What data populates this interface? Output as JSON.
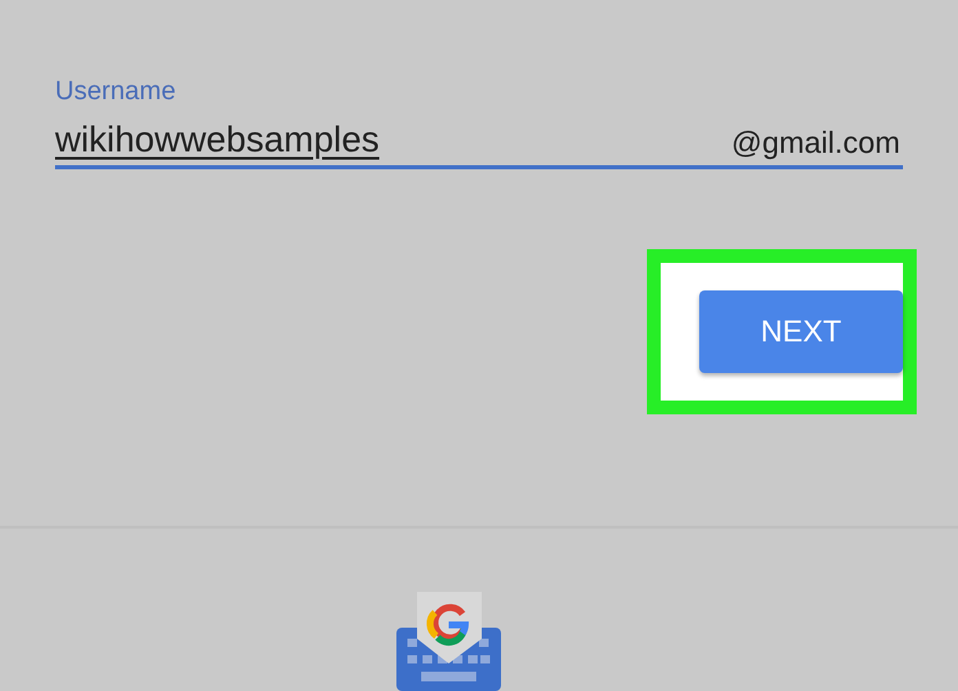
{
  "username_field": {
    "label": "Username",
    "value": "wikihowwebsamples",
    "suffix": "@gmail.com",
    "focused": true
  },
  "next_button": {
    "label": "NEXT",
    "highlighted": true
  }
}
